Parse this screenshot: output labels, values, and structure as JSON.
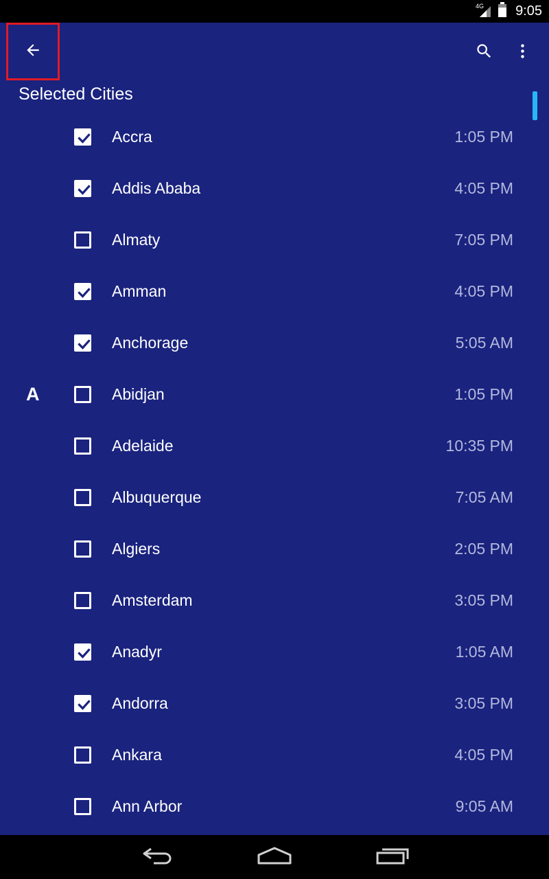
{
  "status_bar": {
    "network": "4G",
    "time": "9:05"
  },
  "app_bar": {
    "back_icon": "arrow-back-icon",
    "search_icon": "search-icon",
    "overflow_icon": "more-vert-icon"
  },
  "section_title": "Selected Cities",
  "index_letter": "A",
  "cities": [
    {
      "name": "Accra",
      "time": "1:05 PM",
      "checked": true
    },
    {
      "name": "Addis Ababa",
      "time": "4:05 PM",
      "checked": true
    },
    {
      "name": "Almaty",
      "time": "7:05 PM",
      "checked": false
    },
    {
      "name": "Amman",
      "time": "4:05 PM",
      "checked": true
    },
    {
      "name": "Anchorage",
      "time": "5:05 AM",
      "checked": true
    },
    {
      "name": "Abidjan",
      "time": "1:05 PM",
      "checked": false
    },
    {
      "name": "Adelaide",
      "time": "10:35 PM",
      "checked": false
    },
    {
      "name": "Albuquerque",
      "time": "7:05 AM",
      "checked": false
    },
    {
      "name": "Algiers",
      "time": "2:05 PM",
      "checked": false
    },
    {
      "name": "Amsterdam",
      "time": "3:05 PM",
      "checked": false
    },
    {
      "name": "Anadyr",
      "time": "1:05 AM",
      "checked": true
    },
    {
      "name": "Andorra",
      "time": "3:05 PM",
      "checked": true
    },
    {
      "name": "Ankara",
      "time": "4:05 PM",
      "checked": false
    },
    {
      "name": "Ann Arbor",
      "time": "9:05 AM",
      "checked": false
    }
  ],
  "nav_bar": {
    "back_icon": "nav-back-icon",
    "home_icon": "nav-home-icon",
    "recents_icon": "nav-recents-icon"
  },
  "colors": {
    "background": "#1a237e",
    "accent": "#29b6f6",
    "highlight_border": "#e01b24"
  }
}
